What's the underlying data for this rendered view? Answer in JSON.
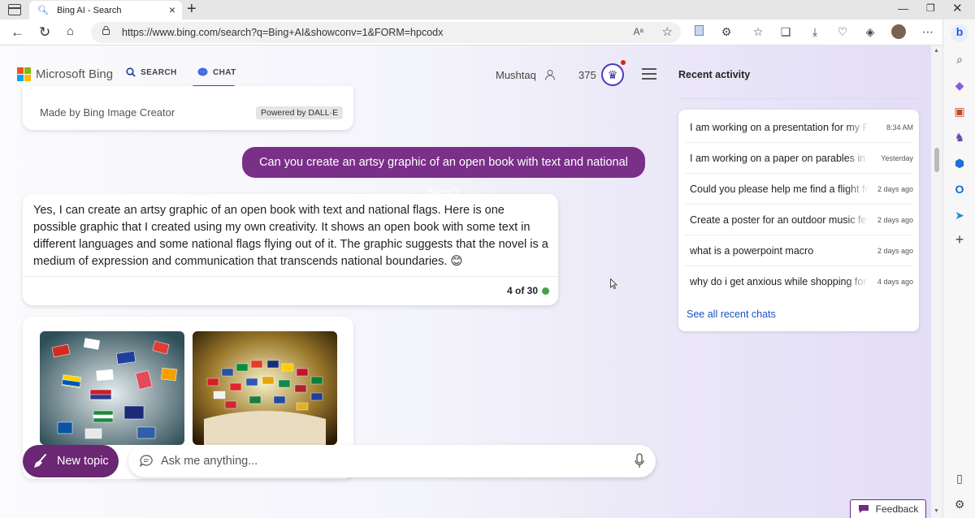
{
  "browser": {
    "tab_title": "Bing AI - Search",
    "url": "https://www.bing.com/search?q=Bing+AI&showconv=1&FORM=hpcodx"
  },
  "header": {
    "brand": "Microsoft Bing",
    "nav_search": "SEARCH",
    "nav_chat": "CHAT",
    "username": "Mushtaq",
    "points": "375"
  },
  "chat": {
    "image_credit": "Made by Bing Image Creator",
    "powered_by": "Powered by DALL·E",
    "user_message": "Can you create an artsy graphic of an open book with text and national flags?",
    "bot_reply": "Yes, I can create an artsy graphic of an open book with text and national flags. Here is one possible graphic that I created using my own creativity. It shows an open book with some text in different languages and some national flags flying out of it. The graphic suggests that the novel is a medium of expression and communication that transcends national boundaries. 😊",
    "turn_counter": "4 of 30"
  },
  "composer": {
    "new_topic": "New topic",
    "placeholder": "Ask me anything..."
  },
  "recent": {
    "title": "Recent activity",
    "items": [
      {
        "text": "I am working on a presentation for my PhD",
        "time": "8:34 AM"
      },
      {
        "text": "I am working on a paper on parables in the",
        "time": "Yesterday"
      },
      {
        "text": "Could you please help me find a flight from",
        "time": "2 days ago"
      },
      {
        "text": "Create a poster for an outdoor music festival",
        "time": "2 days ago"
      },
      {
        "text": "what is a powerpoint macro",
        "time": "2 days ago"
      },
      {
        "text": "why do i get anxious while shopping for c",
        "time": "4 days ago"
      }
    ],
    "see_all": "See all recent chats"
  },
  "feedback": "Feedback",
  "colors": {
    "accent_purple": "#7a2f88",
    "chat_underline": "#174ae4",
    "link": "#1b50c2",
    "status_green": "#4a9e47"
  }
}
